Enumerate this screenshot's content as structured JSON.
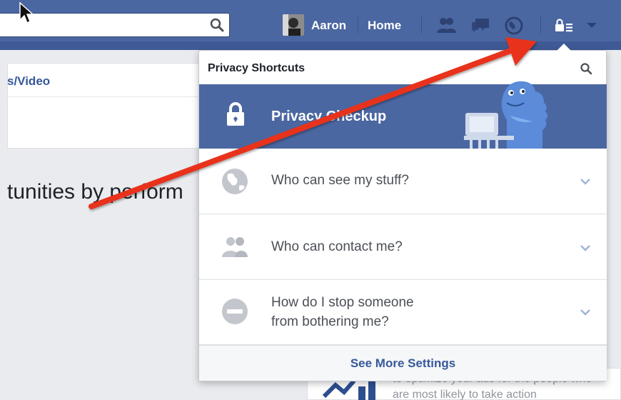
{
  "topbar": {
    "search_placeholder": "",
    "profile_name": "Aaron",
    "home_label": "Home",
    "icons": [
      "search-icon",
      "friend-requests-icon",
      "messages-icon",
      "notifications-globe-icon",
      "privacy-shortcuts-icon",
      "account-menu-caret-icon"
    ],
    "color": "#4b67a1"
  },
  "background_page": {
    "tab_label": "s/Video",
    "heading": "tunities by perform",
    "promo_text": "to optimize your ads for the people who are most likely to take action"
  },
  "privacy_menu": {
    "title": "Privacy Shortcuts",
    "checkup_label": "Privacy Checkup",
    "checkup_color": "#4b67a1",
    "items": [
      {
        "label": "Who can see my stuff?",
        "icon": "globe-icon"
      },
      {
        "label": "Who can contact me?",
        "icon": "people-icon"
      },
      {
        "label": "How do I stop someone",
        "label_line2": "from bothering me?",
        "icon": "block-icon"
      }
    ],
    "see_more_label": "See More Settings",
    "link_color": "#365899"
  },
  "annotation": {
    "arrow_color": "#e8321e"
  }
}
